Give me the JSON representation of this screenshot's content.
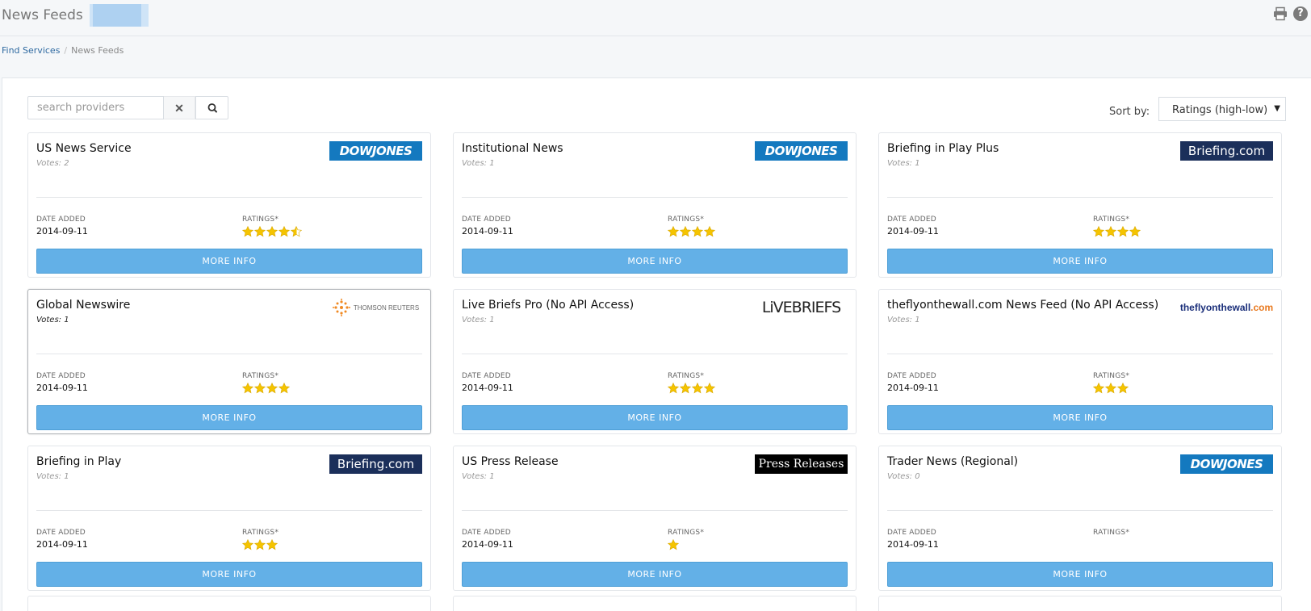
{
  "header": {
    "title": "News Feeds",
    "icons": [
      "print-icon",
      "help-icon"
    ],
    "help_glyph": "?"
  },
  "breadcrumb": {
    "link": "Find Services",
    "separator": "/",
    "current": "News Feeds"
  },
  "toolbar": {
    "search_placeholder": "search providers",
    "search_value": "",
    "clear_glyph": "✕",
    "sort_label": "Sort by:",
    "sort_value": "Ratings (high-low)",
    "sort_arrow": "▼"
  },
  "labels": {
    "date_added": "DATE ADDED",
    "ratings": "RATINGS*",
    "more_info": "MORE INFO"
  },
  "colors": {
    "accent": "#63b0e7",
    "star": "#f5c400",
    "dowjones": "#1479bf",
    "briefing": "#1b2f5a"
  },
  "cards": [
    {
      "title": "US News Service",
      "votes": "Votes: 2",
      "date": "2014-09-11",
      "rating": 4.5,
      "logo": "dowjones"
    },
    {
      "title": "Institutional News",
      "votes": "Votes: 1",
      "date": "2014-09-11",
      "rating": 4,
      "logo": "dowjones"
    },
    {
      "title": "Briefing in Play Plus",
      "votes": "Votes: 1",
      "date": "2014-09-11",
      "rating": 4,
      "logo": "briefing"
    },
    {
      "title": "Global Newswire",
      "votes": "Votes: 1",
      "date": "2014-09-11",
      "rating": 4,
      "logo": "thomson",
      "selected": true
    },
    {
      "title": "Live Briefs Pro (No API Access)",
      "votes": "Votes: 1",
      "date": "2014-09-11",
      "rating": 4,
      "logo": "livebriefs"
    },
    {
      "title": "theflyonthewall.com News Feed (No API Access)",
      "votes": "Votes: 1",
      "date": "2014-09-11",
      "rating": 3,
      "logo": "flyonthewall"
    },
    {
      "title": "Briefing in Play",
      "votes": "Votes: 1",
      "date": "2014-09-11",
      "rating": 3,
      "logo": "briefing"
    },
    {
      "title": "US Press Release",
      "votes": "Votes: 1",
      "date": "2014-09-11",
      "rating": 1,
      "logo": "press"
    },
    {
      "title": "Trader News (Regional)",
      "votes": "Votes: 0",
      "date": "2014-09-11",
      "rating": 0,
      "logo": "dowjones"
    }
  ],
  "logos": {
    "dowjones": "DOWJONES",
    "briefing": "Briefing.com",
    "press": "Press Releases",
    "thomson": "THOMSON REUTERS",
    "livebriefs": "LiVEBRIEFS",
    "flyonthewall": "theflyonthewall",
    "flyonthewall_tld": ".com"
  }
}
